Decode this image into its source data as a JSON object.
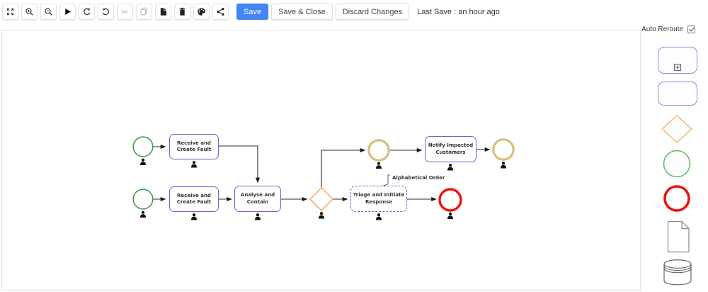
{
  "toolbar": {
    "icon_buttons": [
      {
        "name": "fit-screen"
      },
      {
        "name": "zoom-in"
      },
      {
        "name": "zoom-out"
      },
      {
        "name": "play"
      },
      {
        "name": "undo"
      },
      {
        "name": "redo"
      },
      {
        "name": "cut",
        "disabled": true
      },
      {
        "name": "copy",
        "disabled": true
      },
      {
        "name": "paste"
      },
      {
        "name": "delete"
      },
      {
        "name": "theme-palette"
      },
      {
        "name": "share"
      }
    ],
    "save_label": "Save",
    "save_close_label": "Save & Close",
    "discard_label": "Discard Changes",
    "last_save_text": "Last Save : an hour ago"
  },
  "side_palette": {
    "auto_reroute_label": "Auto Reroute",
    "auto_reroute_checked": true,
    "items": [
      {
        "name": "subprocess"
      },
      {
        "name": "task"
      },
      {
        "name": "gateway"
      },
      {
        "name": "start-event"
      },
      {
        "name": "end-event"
      },
      {
        "name": "document"
      },
      {
        "name": "data-store"
      }
    ]
  },
  "diagram": {
    "tasks": [
      {
        "label": "Receive and Create Fault"
      },
      {
        "label": "Receive and Create Fault"
      },
      {
        "label": "Analyse and Contain"
      },
      {
        "label": "Triage and Initiate Response"
      },
      {
        "label": "Notify Impacted Customers"
      }
    ],
    "annotation_label": "Alphabetical Order"
  },
  "colors": {
    "accent_blue": "#4285f4",
    "task_border": "#6565cf",
    "start_event_green": "#43a047",
    "intermediate_event_tan": "#dcbc7c",
    "end_event_red": "#ee1111",
    "gateway_orange": "#f2a94f"
  }
}
